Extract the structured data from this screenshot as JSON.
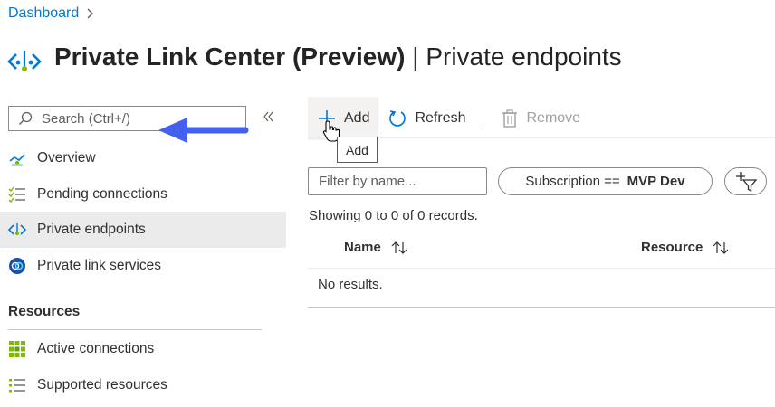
{
  "breadcrumb": {
    "item": "Dashboard"
  },
  "page": {
    "title_main": "Private Link Center (Preview)",
    "title_separator": "|",
    "title_sub": "Private endpoints",
    "icon": "private-link-icon"
  },
  "sidebar": {
    "search_placeholder": "Search (Ctrl+/)",
    "items": [
      {
        "label": "Overview",
        "icon": "overview-icon"
      },
      {
        "label": "Pending connections",
        "icon": "checklist-icon"
      },
      {
        "label": "Private endpoints",
        "icon": "private-endpoint-icon",
        "selected": true
      },
      {
        "label": "Private link services",
        "icon": "link-service-icon"
      }
    ],
    "section": "Resources",
    "resource_items": [
      {
        "label": "Active connections",
        "icon": "grid-icon"
      },
      {
        "label": "Supported resources",
        "icon": "list-icon"
      }
    ]
  },
  "toolbar": {
    "add_label": "Add",
    "refresh_label": "Refresh",
    "remove_label": "Remove",
    "tooltip": "Add"
  },
  "filters": {
    "name_placeholder": "Filter by name...",
    "subscription_key": "Subscription ==",
    "subscription_value": "MVP Dev"
  },
  "records_text": "Showing 0 to 0 of 0 records.",
  "table": {
    "columns": [
      "Name",
      "Resource"
    ],
    "empty_text": "No results."
  },
  "colors": {
    "link": "#0078d4",
    "arrow": "#4361ee",
    "selected_bg": "#ebebeb"
  }
}
